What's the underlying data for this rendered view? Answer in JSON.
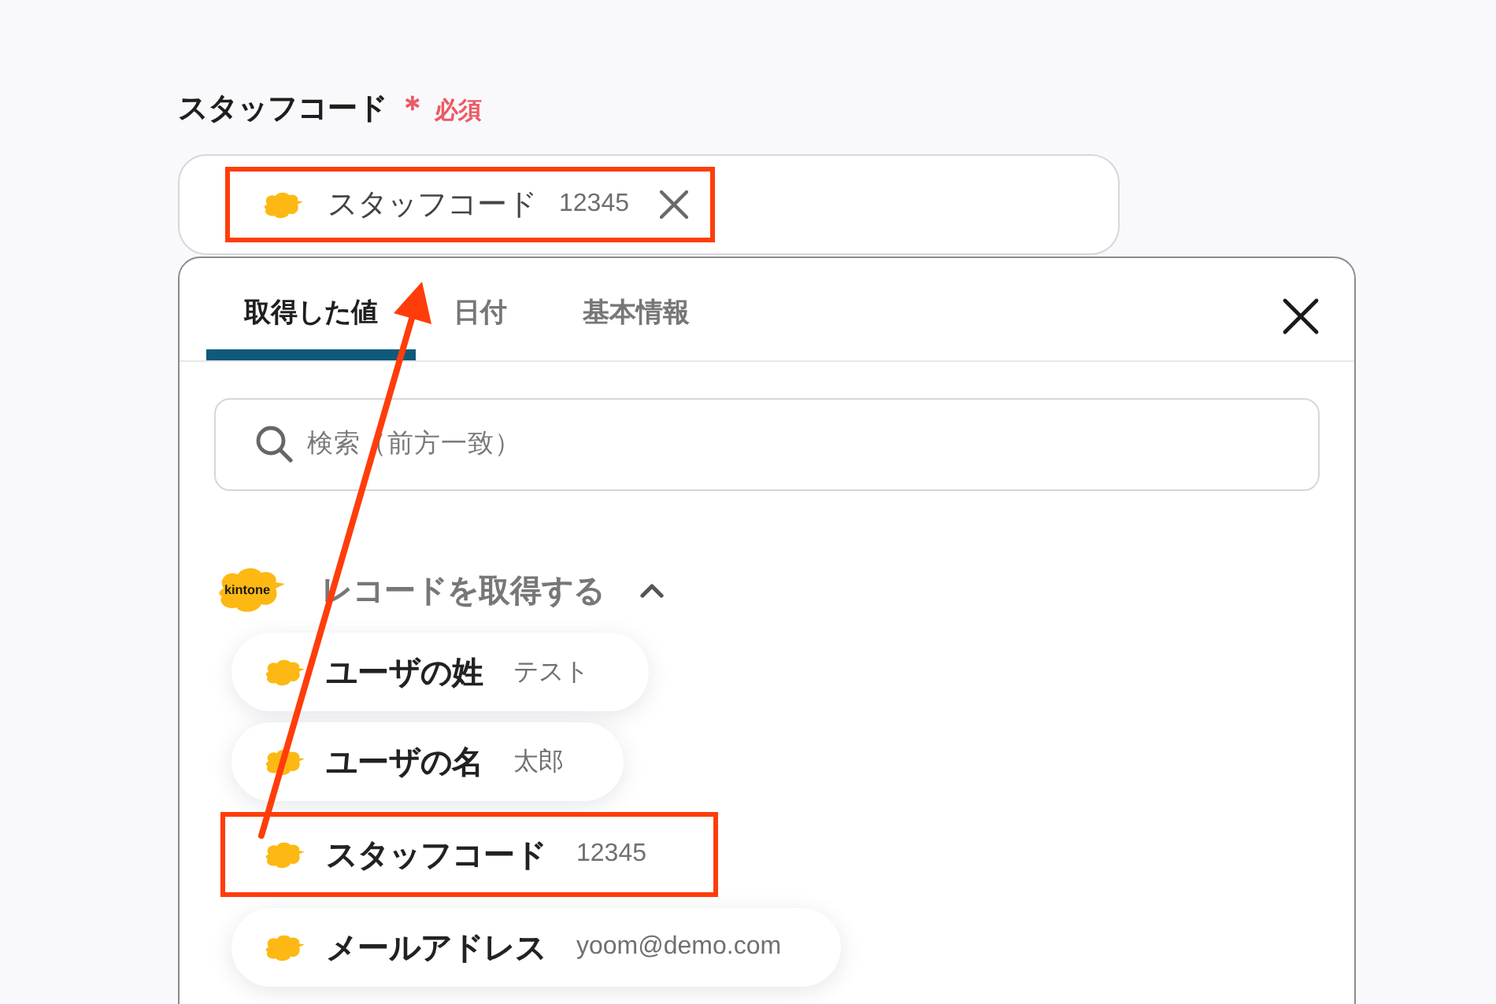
{
  "field": {
    "label": "スタッフコード",
    "required_mark": "＊",
    "required_label": "必須",
    "tokens": [
      {
        "name": "スタッフコード",
        "value": "12345",
        "highlighted": true
      }
    ]
  },
  "picker": {
    "tabs": [
      {
        "label": "取得した値",
        "selected": true
      },
      {
        "label": "日付",
        "selected": false
      },
      {
        "label": "基本情報",
        "selected": false
      }
    ],
    "search": {
      "placeholder": "検索（前方一致）"
    },
    "sections": [
      {
        "logo_text": "kintone",
        "title": "レコードを取得する",
        "expanded": true,
        "items": [
          {
            "name": "ユーザの姓",
            "value": "テスト",
            "highlighted": false
          },
          {
            "name": "ユーザの名",
            "value": "太郎",
            "highlighted": false
          },
          {
            "name": "スタッフコード",
            "value": "12345",
            "highlighted": true
          },
          {
            "name": "メールアドレス",
            "value": "yoom@demo.com",
            "highlighted": false
          }
        ]
      }
    ]
  }
}
